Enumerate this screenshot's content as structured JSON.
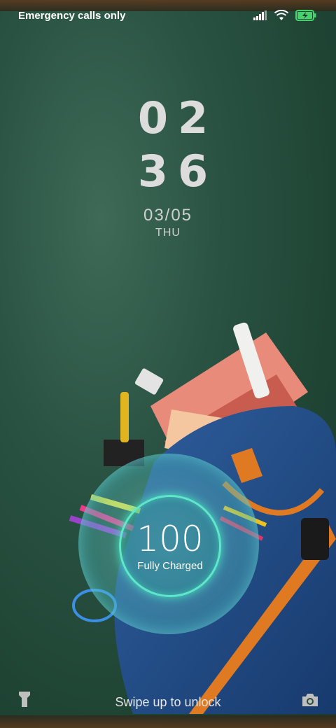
{
  "status_bar": {
    "carrier": "Emergency calls only",
    "icons": [
      "signal-icon",
      "wifi-icon",
      "battery-charging-icon"
    ],
    "battery_color": "#46d36b"
  },
  "clock": {
    "hour": "02",
    "minute": "36"
  },
  "date": {
    "day": "03/05",
    "weekday": "THU"
  },
  "charging": {
    "level": "100",
    "label": "Fully Charged",
    "accent": "#5fe7c9"
  },
  "bottom": {
    "swipe_hint": "Swipe up to unlock",
    "left_icon": "flashlight-icon",
    "right_icon": "camera-icon"
  }
}
